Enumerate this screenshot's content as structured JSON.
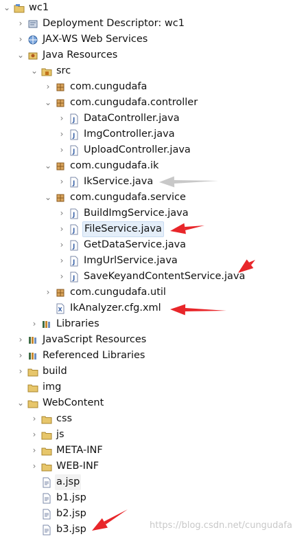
{
  "tree": [
    {
      "label": "wc1",
      "toggle": "open",
      "icon": "project-icon",
      "name": "tree-node-wc1"
    },
    {
      "label": "Deployment Descriptor: wc1",
      "toggle": "closed",
      "icon": "deployment-descriptor-icon",
      "name": "tree-node-deployment-descriptor"
    },
    {
      "label": "JAX-WS Web Services",
      "toggle": "closed",
      "icon": "web-services-icon",
      "name": "tree-node-jax-ws"
    },
    {
      "label": "Java Resources",
      "toggle": "open",
      "icon": "java-resources-icon",
      "name": "tree-node-java-resources"
    },
    {
      "label": "src",
      "toggle": "open",
      "icon": "source-folder-icon",
      "name": "tree-node-src"
    },
    {
      "label": "com.cungudafa",
      "toggle": "closed",
      "icon": "package-icon",
      "name": "tree-node-pkg-root"
    },
    {
      "label": "com.cungudafa.controller",
      "toggle": "open",
      "icon": "package-icon",
      "name": "tree-node-pkg-controller"
    },
    {
      "label": "DataController.java",
      "toggle": "closed",
      "icon": "java-file-icon",
      "name": "tree-node-datacontroller"
    },
    {
      "label": "ImgController.java",
      "toggle": "closed",
      "icon": "java-file-icon",
      "name": "tree-node-imgcontroller"
    },
    {
      "label": "UploadController.java",
      "toggle": "closed",
      "icon": "java-file-icon",
      "name": "tree-node-uploadcontroller"
    },
    {
      "label": "com.cungudafa.ik",
      "toggle": "open",
      "icon": "package-icon",
      "name": "tree-node-pkg-ik"
    },
    {
      "label": "IkService.java",
      "toggle": "closed",
      "icon": "java-file-icon",
      "name": "tree-node-ikservice"
    },
    {
      "label": "com.cungudafa.service",
      "toggle": "open",
      "icon": "package-icon",
      "name": "tree-node-pkg-service"
    },
    {
      "label": "BuildImgService.java",
      "toggle": "closed",
      "icon": "java-file-icon",
      "name": "tree-node-buildimgservice"
    },
    {
      "label": "FileService.java",
      "toggle": "closed",
      "icon": "java-file-icon",
      "name": "tree-node-fileservice",
      "selected": true
    },
    {
      "label": "GetDataService.java",
      "toggle": "closed",
      "icon": "java-file-icon",
      "name": "tree-node-getdataservice"
    },
    {
      "label": "ImgUrlService.java",
      "toggle": "closed",
      "icon": "java-file-icon",
      "name": "tree-node-imgurlservice"
    },
    {
      "label": "SaveKeyandContentService.java",
      "toggle": "closed",
      "icon": "java-file-icon",
      "name": "tree-node-savekeyandcontentservice"
    },
    {
      "label": "com.cungudafa.util",
      "toggle": "closed",
      "icon": "package-icon",
      "name": "tree-node-pkg-util"
    },
    {
      "label": "IkAnalyzer.cfg.xml",
      "toggle": "none",
      "icon": "xml-file-icon",
      "name": "tree-node-ikanalyzer-cfg"
    },
    {
      "label": "Libraries",
      "toggle": "closed",
      "icon": "libraries-icon",
      "name": "tree-node-libraries"
    },
    {
      "label": "JavaScript Resources",
      "toggle": "closed",
      "icon": "libraries-icon",
      "name": "tree-node-javascript-resources"
    },
    {
      "label": "Referenced Libraries",
      "toggle": "closed",
      "icon": "libraries-icon",
      "name": "tree-node-referenced-libraries"
    },
    {
      "label": "build",
      "toggle": "closed",
      "icon": "folder-icon",
      "name": "tree-node-build"
    },
    {
      "label": "img",
      "toggle": "none",
      "icon": "folder-icon",
      "name": "tree-node-img"
    },
    {
      "label": "WebContent",
      "toggle": "open",
      "icon": "folder-icon",
      "name": "tree-node-webcontent"
    },
    {
      "label": "css",
      "toggle": "closed",
      "icon": "folder-icon",
      "name": "tree-node-css"
    },
    {
      "label": "js",
      "toggle": "closed",
      "icon": "folder-icon",
      "name": "tree-node-js"
    },
    {
      "label": "META-INF",
      "toggle": "closed",
      "icon": "folder-icon",
      "name": "tree-node-meta-inf"
    },
    {
      "label": "WEB-INF",
      "toggle": "closed",
      "icon": "folder-icon",
      "name": "tree-node-web-inf"
    },
    {
      "label": "a.jsp",
      "toggle": "none",
      "icon": "jsp-file-icon",
      "name": "tree-node-a-jsp",
      "selected2": true
    },
    {
      "label": "b1.jsp",
      "toggle": "none",
      "icon": "jsp-file-icon",
      "name": "tree-node-b1-jsp"
    },
    {
      "label": "b2.jsp",
      "toggle": "none",
      "icon": "jsp-file-icon",
      "name": "tree-node-b2-jsp"
    },
    {
      "label": "b3.jsp",
      "toggle": "none",
      "icon": "jsp-file-icon",
      "name": "tree-node-b3-jsp"
    }
  ],
  "glyphs": {
    "open": "⌄",
    "closed": "›",
    "none": ""
  },
  "watermark": "https://blog.csdn.net/cungudafa",
  "colors": {
    "annotation_red": "#e8262a",
    "annotation_gray": "#c8c8c8",
    "selection": "#e4eef9"
  }
}
